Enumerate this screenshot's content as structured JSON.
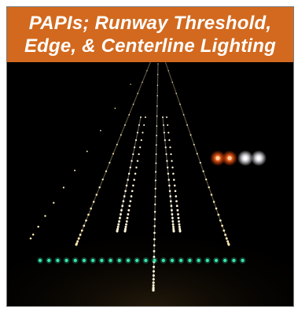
{
  "banner": {
    "line1": "PAPIs;  Runway Threshold,",
    "line2": "Edge, & Centerline Lighting"
  },
  "colors": {
    "banner_bg": "#d2691e",
    "banner_text": "#ffffff",
    "night_sky": "#000000",
    "edge_light": "#ffe9b0",
    "centerline_light": "#fff6d8",
    "threshold_light": "#39e6b0",
    "papi_red": "#ff5a1f",
    "papi_white": "#ffffff"
  },
  "scene": {
    "papi_lights": [
      "red",
      "red",
      "white",
      "white"
    ]
  }
}
